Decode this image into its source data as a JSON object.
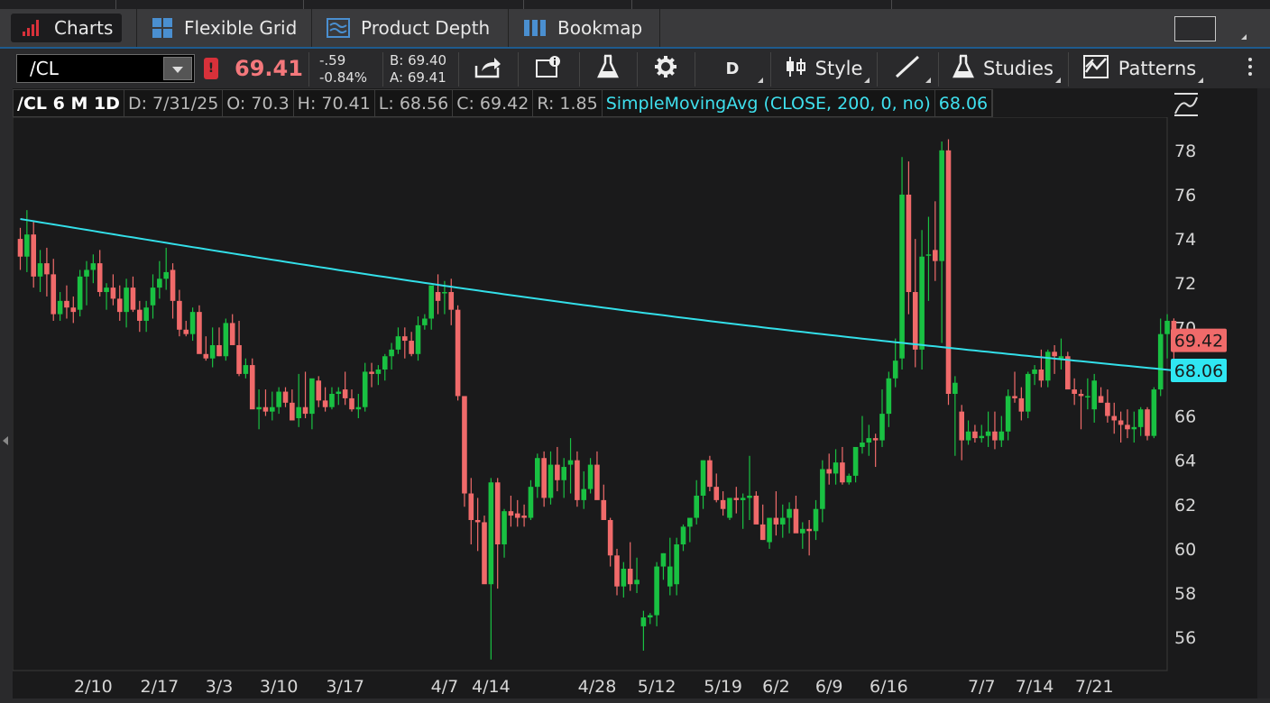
{
  "tabs": [
    {
      "label": "Charts",
      "icon": "bar-chart-icon",
      "active": true
    },
    {
      "label": "Flexible Grid",
      "icon": "grid-icon",
      "active": false
    },
    {
      "label": "Product Depth",
      "icon": "depth-icon",
      "active": false
    },
    {
      "label": "Bookmap",
      "icon": "bookmap-icon",
      "active": false
    }
  ],
  "toolbar": {
    "symbol": "/CL",
    "last": "69.41",
    "change": "-.59",
    "change_pct": "-0.84%",
    "bid": "B: 69.40",
    "ask": "A: 69.41",
    "warning_badge": "!",
    "aggregation": "D",
    "style_label": "Style",
    "studies_label": "Studies",
    "patterns_label": "Patterns"
  },
  "header": {
    "title": "/CL 6 M 1D",
    "date": "D: 7/31/25",
    "open": "O: 70.3",
    "high": "H: 70.41",
    "low": "L: 68.56",
    "close": "C: 69.42",
    "range": "R: 1.85",
    "study": "SimpleMovingAvg (CLOSE, 200, 0, no)",
    "study_value": "68.06"
  },
  "colors": {
    "up": "#19c142",
    "down": "#f06a6a",
    "sma": "#33dfe9",
    "price_tag": "#f06a6a",
    "sma_tag": "#2fe6f2",
    "background": "#1a1a1b"
  },
  "chart_data": {
    "type": "candlestick",
    "ylim": [
      54.5,
      79.5
    ],
    "y_ticks": [
      56,
      58,
      60,
      62,
      64,
      66,
      68,
      70,
      72,
      74,
      76,
      78
    ],
    "x_ticks": [
      {
        "label": "2/10",
        "idx": 11
      },
      {
        "label": "2/17",
        "idx": 21
      },
      {
        "label": "3/3",
        "idx": 30
      },
      {
        "label": "3/10",
        "idx": 39
      },
      {
        "label": "3/17",
        "idx": 49
      },
      {
        "label": "4/7",
        "idx": 64
      },
      {
        "label": "4/14",
        "idx": 71
      },
      {
        "label": "4/28",
        "idx": 87
      },
      {
        "label": "5/12",
        "idx": 96
      },
      {
        "label": "5/19",
        "idx": 106
      },
      {
        "label": "6/2",
        "idx": 114
      },
      {
        "label": "6/9",
        "idx": 122
      },
      {
        "label": "6/16",
        "idx": 131
      },
      {
        "label": "7/7",
        "idx": 145
      },
      {
        "label": "7/14",
        "idx": 153
      },
      {
        "label": "7/21",
        "idx": 162
      }
    ],
    "price_tag": "69.42",
    "sma_tag": "68.06",
    "ohlc": [
      [
        74.0,
        74.5,
        72.6,
        73.2
      ],
      [
        73.2,
        75.3,
        72.5,
        74.2
      ],
      [
        74.2,
        74.8,
        71.8,
        72.3
      ],
      [
        72.3,
        73.5,
        71.6,
        72.9
      ],
      [
        72.9,
        73.6,
        71.4,
        72.4
      ],
      [
        72.4,
        73.1,
        70.3,
        70.6
      ],
      [
        70.6,
        71.6,
        70.3,
        71.2
      ],
      [
        71.2,
        71.9,
        70.4,
        70.9
      ],
      [
        70.9,
        71.4,
        70.2,
        70.7
      ],
      [
        70.8,
        72.6,
        70.5,
        72.3
      ],
      [
        72.3,
        73.0,
        71.0,
        72.6
      ],
      [
        72.6,
        73.3,
        72.0,
        72.9
      ],
      [
        72.9,
        73.5,
        71.4,
        71.6
      ],
      [
        71.6,
        72.0,
        70.8,
        71.8
      ],
      [
        71.8,
        72.4,
        71.0,
        71.3
      ],
      [
        71.3,
        71.9,
        70.3,
        70.7
      ],
      [
        70.7,
        72.2,
        70.0,
        71.8
      ],
      [
        71.8,
        72.3,
        70.7,
        70.8
      ],
      [
        70.8,
        71.2,
        69.8,
        70.3
      ],
      [
        70.3,
        71.2,
        69.8,
        70.9
      ],
      [
        71.0,
        72.4,
        70.4,
        71.8
      ],
      [
        71.8,
        73.0,
        71.3,
        72.2
      ],
      [
        72.2,
        73.6,
        71.7,
        72.5
      ],
      [
        72.6,
        72.9,
        70.4,
        71.2
      ],
      [
        71.2,
        71.7,
        69.6,
        69.9
      ],
      [
        69.9,
        70.3,
        69.6,
        69.7
      ],
      [
        69.7,
        70.9,
        69.4,
        70.7
      ],
      [
        70.7,
        71.0,
        69.8,
        68.8
      ],
      [
        68.8,
        69.6,
        68.5,
        68.6
      ],
      [
        68.6,
        70.0,
        68.2,
        69.2
      ],
      [
        69.2,
        70.0,
        68.7,
        68.7
      ],
      [
        68.7,
        70.4,
        68.5,
        70.2
      ],
      [
        70.2,
        70.6,
        69.3,
        69.2
      ],
      [
        69.2,
        70.3,
        67.8,
        67.9
      ],
      [
        67.9,
        68.6,
        67.7,
        68.3
      ],
      [
        68.3,
        68.6,
        66.4,
        66.3
      ],
      [
        66.3,
        67.2,
        65.4,
        66.4
      ],
      [
        66.4,
        67.2,
        66.0,
        66.2
      ],
      [
        66.2,
        67.1,
        65.8,
        66.4
      ],
      [
        66.4,
        67.3,
        66.1,
        67.1
      ],
      [
        67.1,
        67.3,
        66.4,
        66.6
      ],
      [
        66.6,
        67.2,
        66.5,
        65.8
      ],
      [
        65.9,
        67.9,
        65.5,
        66.4
      ],
      [
        66.4,
        68.0,
        65.9,
        66.1
      ],
      [
        66.1,
        67.2,
        65.4,
        67.7
      ],
      [
        67.6,
        67.8,
        66.4,
        66.7
      ],
      [
        66.7,
        67.3,
        66.2,
        66.4
      ],
      [
        66.4,
        67.3,
        66.3,
        67.0
      ],
      [
        67.0,
        67.3,
        66.5,
        67.1
      ],
      [
        67.2,
        68.0,
        66.5,
        66.8
      ],
      [
        66.8,
        67.2,
        66.2,
        66.3
      ],
      [
        66.3,
        67.0,
        65.9,
        66.4
      ],
      [
        66.4,
        68.4,
        66.2,
        68.0
      ],
      [
        68.0,
        68.4,
        67.3,
        67.9
      ],
      [
        67.9,
        68.3,
        67.4,
        68.1
      ],
      [
        68.1,
        68.8,
        67.6,
        68.7
      ],
      [
        68.7,
        69.3,
        68.1,
        69.0
      ],
      [
        69.0,
        70.0,
        68.8,
        69.6
      ],
      [
        69.6,
        70.0,
        68.6,
        69.4
      ],
      [
        69.4,
        69.8,
        68.7,
        68.8
      ],
      [
        68.8,
        70.5,
        68.5,
        70.1
      ],
      [
        70.1,
        70.6,
        69.9,
        70.4
      ],
      [
        70.4,
        71.8,
        69.9,
        71.9
      ],
      [
        71.6,
        72.4,
        70.6,
        71.2
      ],
      [
        71.6,
        72.1,
        70.6,
        71.6
      ],
      [
        71.6,
        72.2,
        70.1,
        70.8
      ],
      [
        70.8,
        71.0,
        66.7,
        66.9
      ],
      [
        66.9,
        66.9,
        61.9,
        62.5
      ],
      [
        62.5,
        63.2,
        60.2,
        61.3
      ],
      [
        61.3,
        62.3,
        59.9,
        61.2
      ],
      [
        61.2,
        61.5,
        59.2,
        58.4
      ],
      [
        58.4,
        63.2,
        55.0,
        63.0
      ],
      [
        63.0,
        63.2,
        58.2,
        60.2
      ],
      [
        60.2,
        61.8,
        59.6,
        61.7
      ],
      [
        61.7,
        62.4,
        61.0,
        61.5
      ],
      [
        61.6,
        62.2,
        61.0,
        61.4
      ],
      [
        61.5,
        62.0,
        61.0,
        61.4
      ],
      [
        61.4,
        63.1,
        61.3,
        62.8
      ],
      [
        62.8,
        64.3,
        62.3,
        64.1
      ],
      [
        64.1,
        64.4,
        61.9,
        62.3
      ],
      [
        62.3,
        64.4,
        62.0,
        63.8
      ],
      [
        63.8,
        64.6,
        62.6,
        63.1
      ],
      [
        63.1,
        64.1,
        62.3,
        63.7
      ],
      [
        63.8,
        65.0,
        62.5,
        64.0
      ],
      [
        64.0,
        64.4,
        61.9,
        62.2
      ],
      [
        62.2,
        63.5,
        61.8,
        62.7
      ],
      [
        62.7,
        64.1,
        62.5,
        63.8
      ],
      [
        63.8,
        64.4,
        62.6,
        62.2
      ],
      [
        62.2,
        62.9,
        61.9,
        61.3
      ],
      [
        61.3,
        61.4,
        59.2,
        59.7
      ],
      [
        59.7,
        60.0,
        57.9,
        58.3
      ],
      [
        58.3,
        59.4,
        57.8,
        59.1
      ],
      [
        59.1,
        60.3,
        58.1,
        58.4
      ],
      [
        58.4,
        59.6,
        58.0,
        58.6
      ],
      [
        56.5,
        57.2,
        55.4,
        56.9
      ],
      [
        56.9,
        57.1,
        56.6,
        57.0
      ],
      [
        57.0,
        59.4,
        56.5,
        59.2
      ],
      [
        59.2,
        59.8,
        58.6,
        59.8
      ],
      [
        58.3,
        60.5,
        57.9,
        59.2
      ],
      [
        58.4,
        60.5,
        57.9,
        60.2
      ],
      [
        60.2,
        61.1,
        59.9,
        61.0
      ],
      [
        61.0,
        61.3,
        60.3,
        61.4
      ],
      [
        61.4,
        63.1,
        61.1,
        62.4
      ],
      [
        62.4,
        64.0,
        61.8,
        64.0
      ],
      [
        64.0,
        64.2,
        62.6,
        62.8
      ],
      [
        62.8,
        63.4,
        62.1,
        62.2
      ],
      [
        62.2,
        62.6,
        61.5,
        61.8
      ],
      [
        61.4,
        62.3,
        61.3,
        62.3
      ],
      [
        62.3,
        62.8,
        61.6,
        62.2
      ],
      [
        62.2,
        62.5,
        60.9,
        62.3
      ],
      [
        62.3,
        64.2,
        61.3,
        62.4
      ],
      [
        62.4,
        62.6,
        61.3,
        61.1
      ],
      [
        61.1,
        62.0,
        60.4,
        60.4
      ],
      [
        60.3,
        61.3,
        60.0,
        61.4
      ],
      [
        61.4,
        62.6,
        60.6,
        61.1
      ],
      [
        61.1,
        62.0,
        60.5,
        61.4
      ],
      [
        61.4,
        62.1,
        60.7,
        61.8
      ],
      [
        61.8,
        62.4,
        60.8,
        60.7
      ],
      [
        60.7,
        61.2,
        60.0,
        60.9
      ],
      [
        60.9,
        61.3,
        59.7,
        60.8
      ],
      [
        60.8,
        62.2,
        60.4,
        61.8
      ],
      [
        61.8,
        64.0,
        61.2,
        63.6
      ],
      [
        63.6,
        64.3,
        62.9,
        63.4
      ],
      [
        63.4,
        64.5,
        62.9,
        63.9
      ],
      [
        63.9,
        64.6,
        62.9,
        63.0
      ],
      [
        63.0,
        63.4,
        62.9,
        63.3
      ],
      [
        63.3,
        64.5,
        63.0,
        64.6
      ],
      [
        64.6,
        66.0,
        64.3,
        64.8
      ],
      [
        64.8,
        65.6,
        64.2,
        65.0
      ],
      [
        65.0,
        65.2,
        63.7,
        64.9
      ],
      [
        64.9,
        67.2,
        64.6,
        66.1
      ],
      [
        66.1,
        68.0,
        65.5,
        67.7
      ],
      [
        67.7,
        69.5,
        67.3,
        68.5
      ],
      [
        68.6,
        77.7,
        68.1,
        76.0
      ],
      [
        76.0,
        77.5,
        70.6,
        71.6
      ],
      [
        71.6,
        74.0,
        68.2,
        69.0
      ],
      [
        69.0,
        74.4,
        68.1,
        73.2
      ],
      [
        73.3,
        75.0,
        71.2,
        73.3
      ],
      [
        73.5,
        75.7,
        72.1,
        73.0
      ],
      [
        73.0,
        78.4,
        69.3,
        78.0
      ],
      [
        78.0,
        78.5,
        66.5,
        67.0
      ],
      [
        67.0,
        67.8,
        64.2,
        67.5
      ],
      [
        66.2,
        66.5,
        64.0,
        64.9
      ],
      [
        64.9,
        65.8,
        64.7,
        65.3
      ],
      [
        65.3,
        65.6,
        64.8,
        65.0
      ],
      [
        65.0,
        65.6,
        64.8,
        65.1
      ],
      [
        65.1,
        66.2,
        64.6,
        65.3
      ],
      [
        65.3,
        66.2,
        64.5,
        64.9
      ],
      [
        64.9,
        66.0,
        64.6,
        65.3
      ],
      [
        65.3,
        67.2,
        64.9,
        66.9
      ],
      [
        66.9,
        68.0,
        66.6,
        66.8
      ],
      [
        66.8,
        67.3,
        65.8,
        66.2
      ],
      [
        66.2,
        68.0,
        65.9,
        67.9
      ],
      [
        67.9,
        68.3,
        67.4,
        68.1
      ],
      [
        68.1,
        69.0,
        67.3,
        67.6
      ],
      [
        67.6,
        69.0,
        67.3,
        68.9
      ],
      [
        68.9,
        69.2,
        67.9,
        68.7
      ],
      [
        68.6,
        69.5,
        68.1,
        68.7
      ],
      [
        68.7,
        68.9,
        67.3,
        67.2
      ],
      [
        67.2,
        67.7,
        66.5,
        67.0
      ],
      [
        67.0,
        67.2,
        65.4,
        66.9
      ],
      [
        66.9,
        67.7,
        66.3,
        66.9
      ],
      [
        66.3,
        67.9,
        65.7,
        67.6
      ],
      [
        66.9,
        67.3,
        66.6,
        66.6
      ],
      [
        66.6,
        67.2,
        65.7,
        66.0
      ],
      [
        66.0,
        66.6,
        65.2,
        65.8
      ],
      [
        65.8,
        66.2,
        64.8,
        65.6
      ],
      [
        65.6,
        66.3,
        65.0,
        65.4
      ],
      [
        65.4,
        66.2,
        64.8,
        65.5
      ],
      [
        65.5,
        66.4,
        65.1,
        66.3
      ],
      [
        66.3,
        66.4,
        64.9,
        65.1
      ],
      [
        65.1,
        67.3,
        65.0,
        67.2
      ],
      [
        67.2,
        70.4,
        66.9,
        69.7
      ],
      [
        69.7,
        70.6,
        68.6,
        70.3
      ],
      [
        70.3,
        70.41,
        68.56,
        69.42
      ]
    ]
  }
}
